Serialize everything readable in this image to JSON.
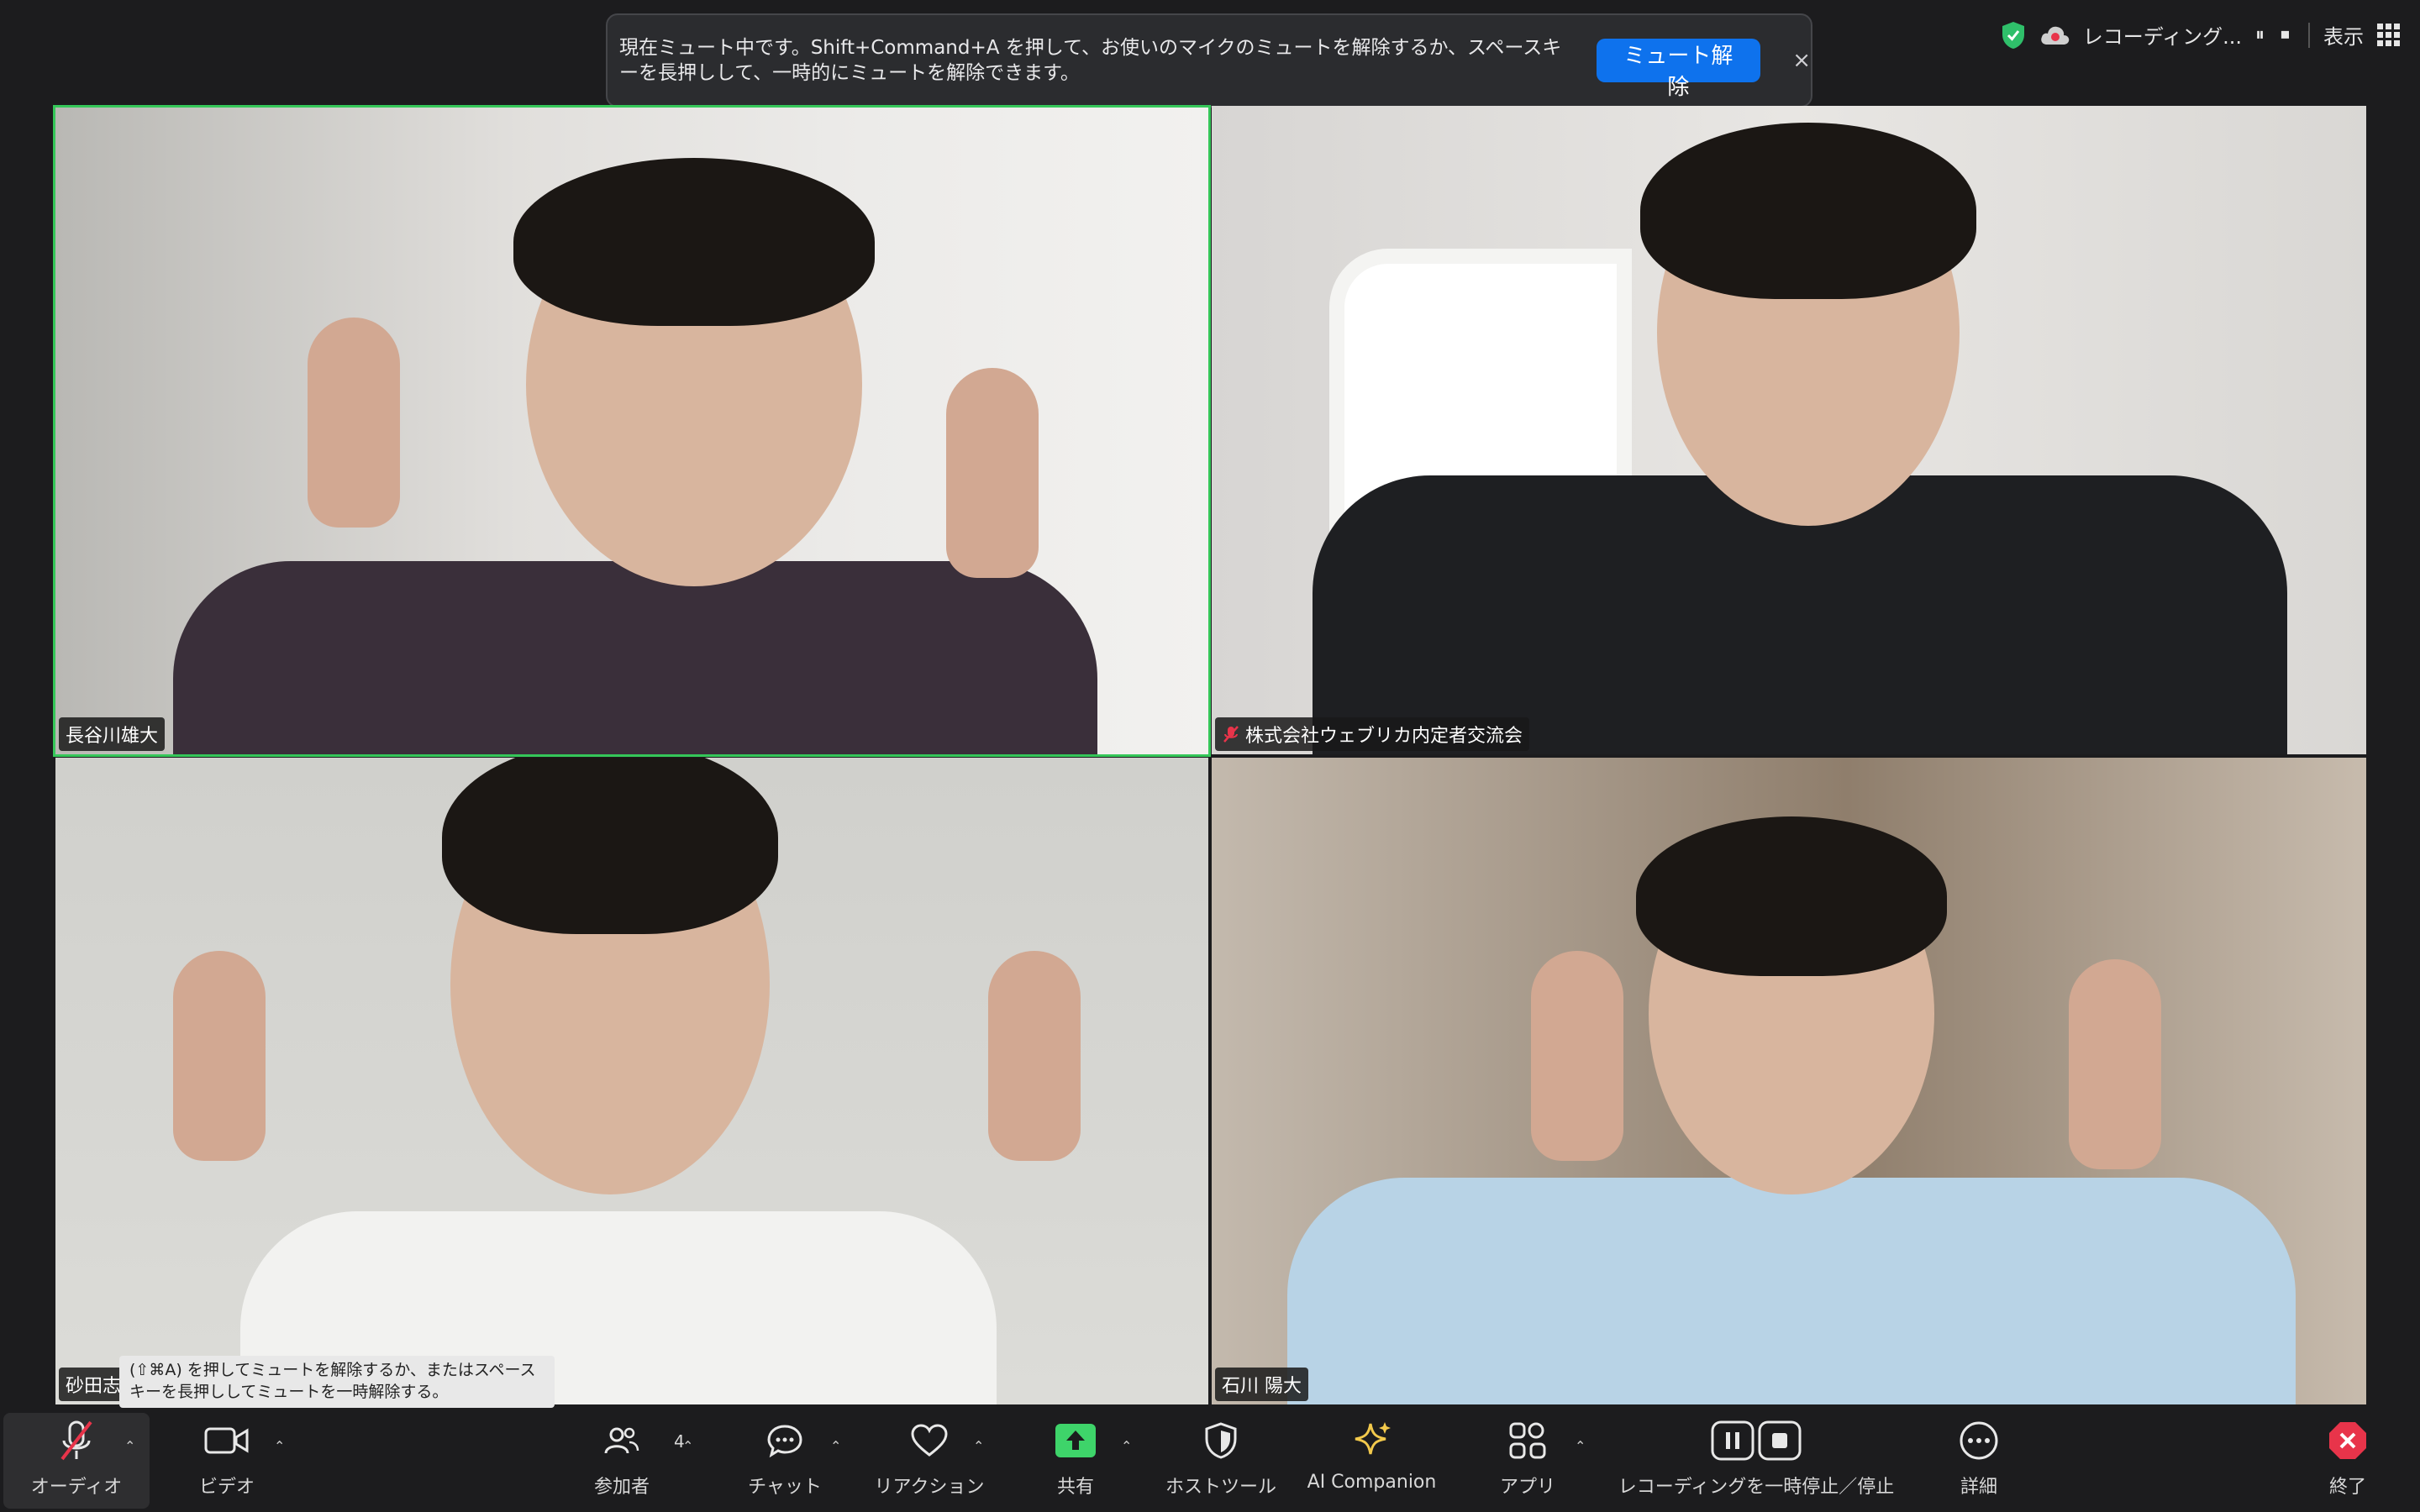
{
  "banner": {
    "message": "現在ミュート中です。Shift+Command+A を押して、お使いのマイクのミュートを解除するか、スペースキーを長押しして、一時的にミュートを解除できます。",
    "unmute_button": "ミュート解除",
    "close": "×"
  },
  "top_right": {
    "recording_label": "レコーディング...",
    "recording_controls": "⏸ ⏹",
    "view_label": "表示"
  },
  "participants": [
    {
      "name": "長谷川雄大",
      "active_speaker": true
    },
    {
      "name": "株式会社ウェブリカ内定者交流会",
      "muted": true
    },
    {
      "name": "砂田志"
    },
    {
      "name": "石川 陽大"
    }
  ],
  "tooltip": "(⇧⌘A) を押してミュートを解除するか、またはスペースキーを長押ししてミュートを一時解除する。",
  "toolbar": {
    "audio": "オーディオ",
    "video": "ビデオ",
    "participants": "参加者",
    "participants_count": "4",
    "chat": "チャット",
    "reactions": "リアクション",
    "share": "共有",
    "host_tools": "ホストツール",
    "ai_companion": "AI Companion",
    "apps": "アプリ",
    "recording": "レコーディングを一時停止／停止",
    "more": "詳細",
    "end": "終了"
  },
  "colors": {
    "accent_blue": "#0e72ed",
    "active_speaker_border": "#35c759",
    "share_green": "#3ed46a",
    "end_red": "#e8344a",
    "shield_green": "#2fbf6a"
  }
}
